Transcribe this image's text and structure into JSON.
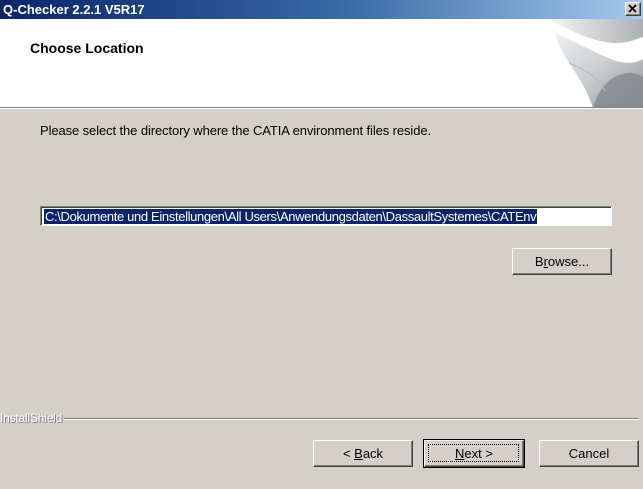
{
  "window": {
    "title": "Q-Checker 2.2.1 V5R17"
  },
  "header": {
    "title": "Choose Location"
  },
  "main": {
    "prompt": "Please select the directory where the CATIA environment files reside.",
    "path_value": "C:\\Dokumente und Einstellungen\\All Users\\Anwendungsdaten\\DassaultSystemes\\CATEnv"
  },
  "buttons": {
    "browse_pre": "B",
    "browse_mnemonic": "r",
    "browse_post": "owse...",
    "back_pre": "< ",
    "back_mnemonic": "B",
    "back_post": "ack",
    "next_mnemonic": "N",
    "next_post": "ext >",
    "cancel": "Cancel"
  },
  "footer": {
    "brand": "InstallShield"
  },
  "icons": {
    "close": "close-icon",
    "header_art": "wizard-page-curl-graphic"
  },
  "colors": {
    "title_bar_start": "#0a246a",
    "title_bar_end": "#a6caf0",
    "dialog_face": "#d4d0c8",
    "selection": "#0a246a"
  }
}
